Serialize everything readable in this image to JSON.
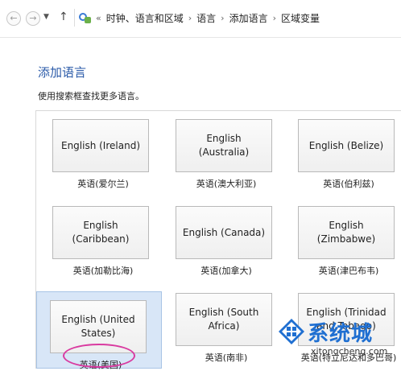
{
  "breadcrumb": {
    "overflow": "«",
    "items": [
      "时钟、语言和区域",
      "语言",
      "添加语言",
      "区域变量"
    ]
  },
  "page": {
    "title": "添加语言",
    "subtitle": "使用搜索框查找更多语言。"
  },
  "languages": [
    {
      "tile": "English (Ireland)",
      "caption": "英语(爱尔兰)"
    },
    {
      "tile": "English (Australia)",
      "caption": "英语(澳大利亚)"
    },
    {
      "tile": "English (Belize)",
      "caption": "英语(伯利兹)"
    },
    {
      "tile": "English (Caribbean)",
      "caption": "英语(加勒比海)"
    },
    {
      "tile": "English (Canada)",
      "caption": "英语(加拿大)"
    },
    {
      "tile": "English (Zimbabwe)",
      "caption": "英语(津巴布韦)"
    },
    {
      "tile": "English (United States)",
      "caption": "英语(美国)"
    },
    {
      "tile": "English (South Africa)",
      "caption": "英语(南非)"
    },
    {
      "tile": "English (Trinidad and Tobago)",
      "caption": "英语(特立尼达和多巴哥)"
    }
  ],
  "selected_index": 6,
  "watermark": {
    "text": "系统城",
    "url": "xitongcheng.com"
  },
  "colors": {
    "title": "#2a5aa8",
    "selection": "#d8e6f7",
    "highlight_ellipse": "#d93aa0"
  }
}
